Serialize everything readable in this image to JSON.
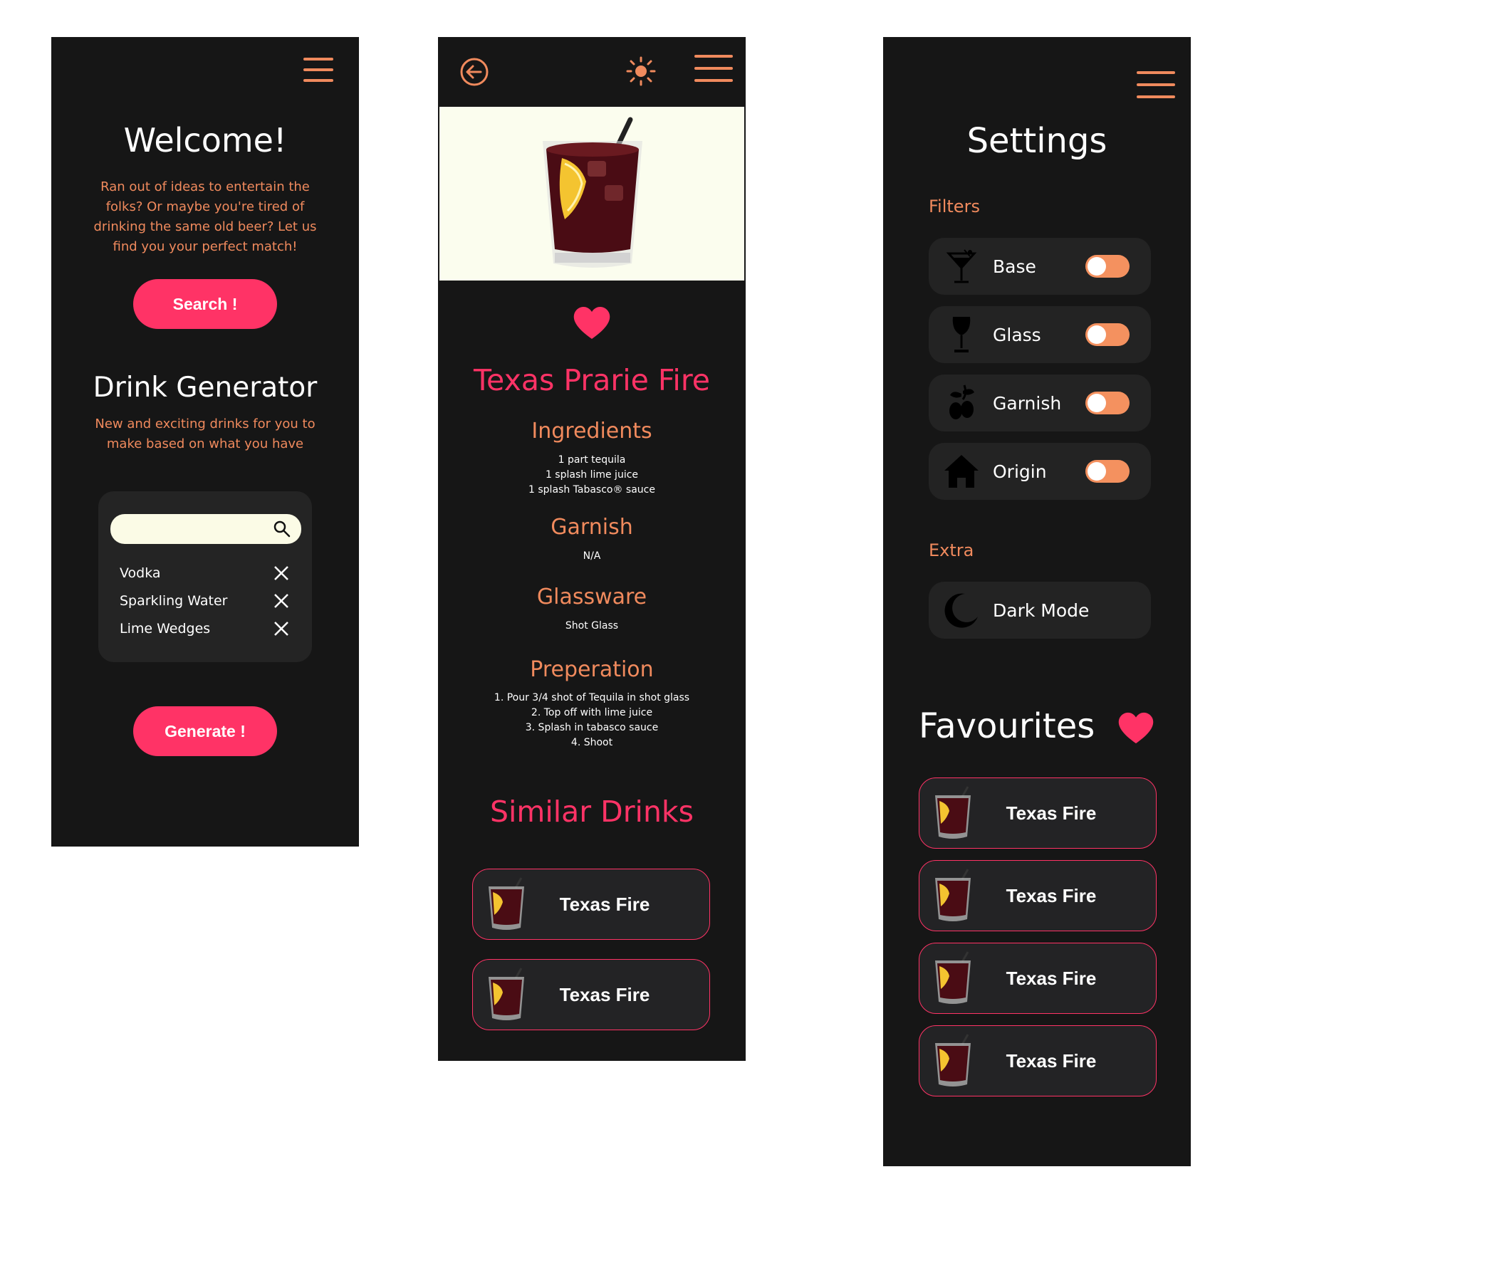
{
  "welcome_screen": {
    "title": "Welcome!",
    "intro": "Ran out of ideas to entertain the folks? Or maybe you're tired of drinking the same old beer? Let us find you your perfect match!",
    "search_button": "Search !",
    "generator_title": "Drink Generator",
    "generator_sub": "New and exciting drinks for you to make based on what you have",
    "search_placeholder": "",
    "ingredients": [
      "Vodka",
      "Sparkling Water",
      "Lime Wedges"
    ],
    "generate_button": "Generate !"
  },
  "drink_screen": {
    "name": "Texas Prarie Fire",
    "ingredients_title": "Ingredients",
    "ingredients": [
      "1 part tequila",
      "1 splash lime juice",
      "1 splash Tabasco® sauce"
    ],
    "garnish_title": "Garnish",
    "garnish": "N/A",
    "glassware_title": "Glassware",
    "glassware": "Shot Glass",
    "prep_title": "Preperation",
    "steps": [
      "1. Pour 3/4 shot of Tequila in shot glass",
      "2. Top off with lime juice",
      "3. Splash in tabasco sauce",
      "4. Shoot"
    ],
    "similar_title": "Similar Drinks",
    "similar": [
      "Texas Fire",
      "Texas Fire"
    ]
  },
  "settings_screen": {
    "title": "Settings",
    "filters_title": "Filters",
    "filters": [
      {
        "label": "Base",
        "icon": "cocktail-glass-icon",
        "on": true
      },
      {
        "label": "Glass",
        "icon": "wine-glass-icon",
        "on": true
      },
      {
        "label": "Garnish",
        "icon": "olive-icon",
        "on": true
      },
      {
        "label": "Origin",
        "icon": "house-icon",
        "on": true
      }
    ],
    "extra_title": "Extra",
    "dark_mode": "Dark Mode",
    "favourites_title": "Favourites",
    "favourites": [
      "Texas Fire",
      "Texas Fire",
      "Texas Fire",
      "Texas Fire"
    ]
  },
  "colors": {
    "background": "#161616",
    "accent_pink": "#ff3366",
    "accent_salmon": "#f08a5d",
    "card": "#232325"
  }
}
